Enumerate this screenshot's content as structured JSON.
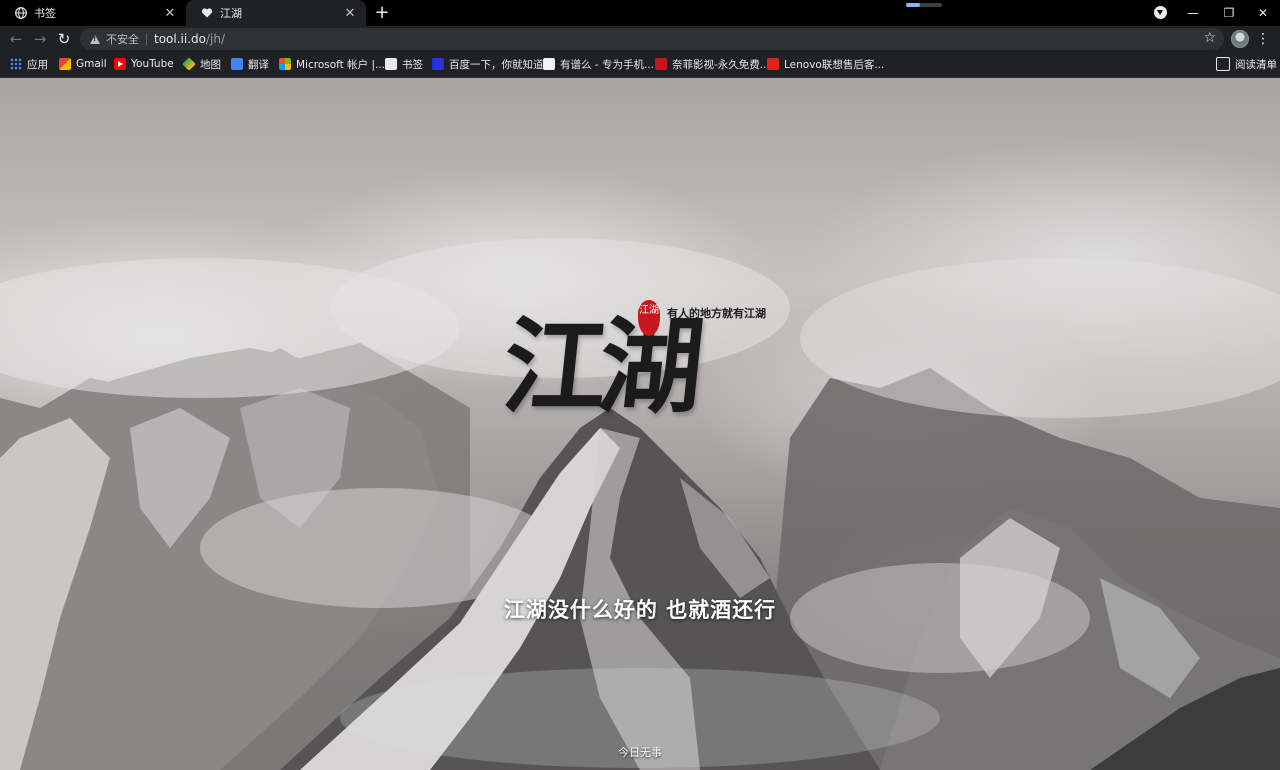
{
  "tabs": [
    {
      "title": "书签",
      "icon": "globe-icon",
      "close": "✕"
    },
    {
      "title": "江湖",
      "icon": "heart-icon",
      "close": "✕"
    }
  ],
  "new_tab_label": "+",
  "toolbar": {
    "back": "←",
    "forward": "→",
    "reload": "↻",
    "security_label": "不安全",
    "url_host": "tool.ii.do",
    "url_path": "/jh/",
    "star": "☆",
    "menu": "⋮"
  },
  "window_controls": {
    "minimize": "—",
    "restore": "❐",
    "close": "✕"
  },
  "bookmarks": [
    {
      "label": "应用",
      "icon": "apps-icon"
    },
    {
      "label": "Gmail",
      "icon": "gmail-icon"
    },
    {
      "label": "YouTube",
      "icon": "youtube-icon"
    },
    {
      "label": "地图",
      "icon": "maps-icon"
    },
    {
      "label": "翻译",
      "icon": "translate-icon"
    },
    {
      "label": "Microsoft 帐户 |...",
      "icon": "microsoft-icon"
    },
    {
      "label": "书签",
      "icon": "globe-icon"
    },
    {
      "label": "百度一下，你就知道",
      "icon": "baidu-icon"
    },
    {
      "label": "有谱么 - 专为手机...",
      "icon": "youpu-icon"
    },
    {
      "label": "奈菲影视-永久免费...",
      "icon": "naifei-icon"
    },
    {
      "label": "Lenovo联想售后客...",
      "icon": "lenovo-icon"
    }
  ],
  "reading_list": "阅读清单",
  "page": {
    "logo_text": "江湖",
    "seal_text": "江湖",
    "motto": "有人的地方就有江湖",
    "slogan": "江湖没什么好的 也就酒还行",
    "footer": "今日无事"
  },
  "colors": {
    "accent": "#8ab4f8",
    "seal": "#c8171e",
    "chrome_dark": "#202124"
  }
}
